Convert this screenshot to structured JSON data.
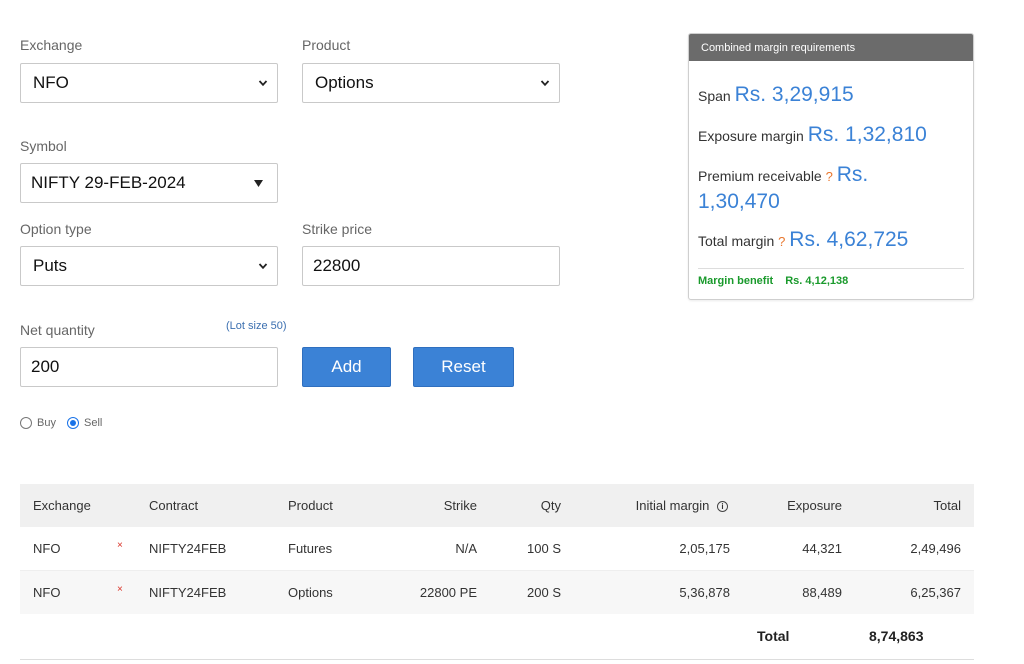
{
  "form": {
    "exchange_label": "Exchange",
    "exchange_value": "NFO",
    "product_label": "Product",
    "product_value": "Options",
    "symbol_label": "Symbol",
    "symbol_value": "NIFTY 29-FEB-2024",
    "option_type_label": "Option type",
    "option_type_value": "Puts",
    "strike_label": "Strike price",
    "strike_value": "22800",
    "net_qty_label": "Net quantity",
    "lot_size": "(Lot size 50)",
    "net_qty_value": "200",
    "add_label": "Add",
    "reset_label": "Reset",
    "buy_label": "Buy",
    "sell_label": "Sell",
    "side_selected": "Sell"
  },
  "margin_card": {
    "title": "Combined margin requirements",
    "span_label": "Span",
    "span_value": "Rs. 3,29,915",
    "exposure_label": "Exposure margin",
    "exposure_value": "Rs. 1,32,810",
    "premium_label": "Premium receivable",
    "premium_value_1": "Rs.",
    "premium_value_2": "1,30,470",
    "total_label": "Total margin",
    "total_value": "Rs. 4,62,725",
    "benefit_label": "Margin benefit",
    "benefit_value": "Rs. 4,12,138",
    "help_glyph": "?"
  },
  "table": {
    "headers": {
      "exchange": "Exchange",
      "contract": "Contract",
      "product": "Product",
      "strike": "Strike",
      "qty": "Qty",
      "initial_margin": "Initial margin",
      "exposure": "Exposure",
      "total": "Total"
    },
    "rows": [
      {
        "exchange": "NFO",
        "remove": "×",
        "contract": "NIFTY24FEB",
        "product": "Futures",
        "strike": "N/A",
        "qty": "100 S",
        "initial_margin": "2,05,175",
        "exposure": "44,321",
        "total": "2,49,496"
      },
      {
        "exchange": "NFO",
        "remove": "×",
        "contract": "NIFTY24FEB",
        "product": "Options",
        "strike": "22800 PE",
        "qty": "200 S",
        "initial_margin": "5,36,878",
        "exposure": "88,489",
        "total": "6,25,367"
      }
    ],
    "footer_label": "Total",
    "footer_value": "8,74,863"
  },
  "colors": {
    "accent": "#3b82d6",
    "benefit": "#1a9a2c",
    "remove": "#d93025",
    "card_header": "#6b6b6b"
  }
}
